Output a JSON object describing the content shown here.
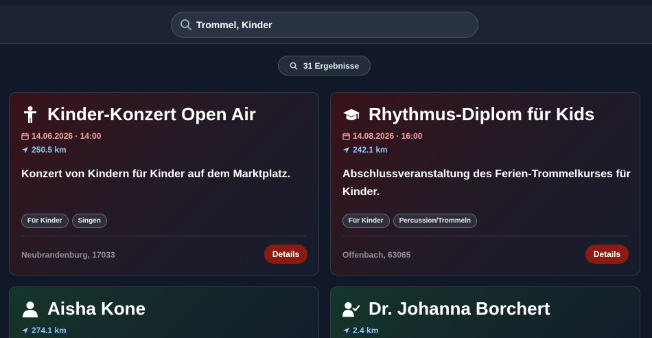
{
  "search": {
    "value": "Trommel, Kinder",
    "icon": "search-icon"
  },
  "results": {
    "label": "31 Ergebnisse"
  },
  "events": [
    {
      "title": "Kinder-Konzert Open Air",
      "icon": "child-icon",
      "date": "14.06.2026 · 14:00",
      "distance": "250.5 km",
      "description": "Konzert von Kindern für Kinder auf dem Marktplatz.",
      "tags": [
        "Für Kinder",
        "Singen"
      ],
      "location": "Neubrandenburg, 17033",
      "details_label": "Details"
    },
    {
      "title": "Rhythmus-Diplom für Kids",
      "icon": "graduation-cap-icon",
      "date": "14.08.2026 · 16:00",
      "distance": "242.1 km",
      "description": "Abschlussveranstaltung des Ferien-Trommelkurses für Kinder.",
      "tags": [
        "Für Kinder",
        "Percussion/Trommeln"
      ],
      "location": "Offenbach, 63065",
      "details_label": "Details"
    }
  ],
  "people": [
    {
      "name": "Aisha Kone",
      "icon": "user-icon",
      "distance": "274.1 km"
    },
    {
      "name": "Dr. Johanna Borchert",
      "icon": "user-check-icon",
      "distance": "2.4 km"
    }
  ],
  "colors": {
    "background": "#111827",
    "date_text": "#f8a4a4",
    "distance_text": "#93c5fd",
    "details_button": "#8b1b12"
  }
}
